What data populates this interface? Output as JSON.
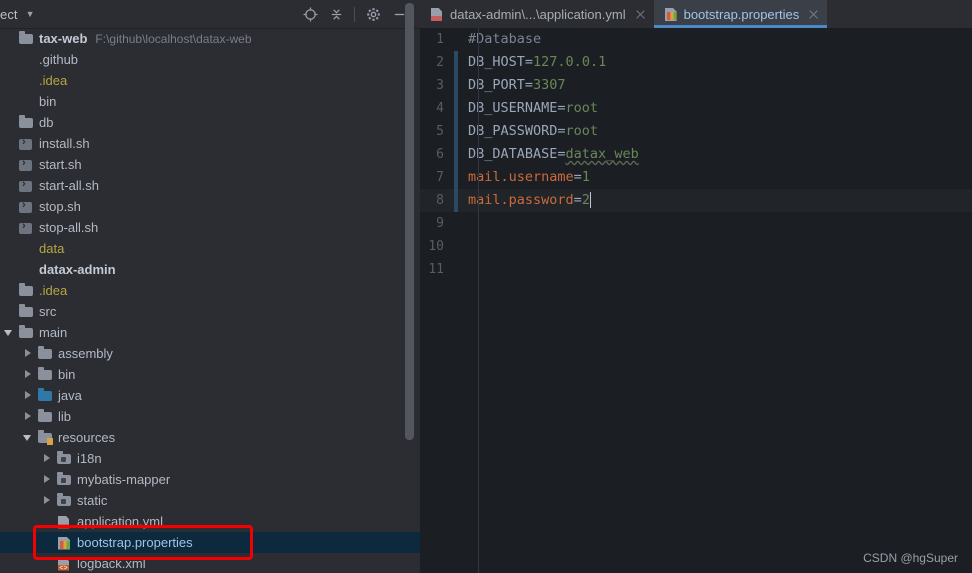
{
  "project_panel": {
    "title": "ect",
    "title_caret": "▼",
    "tools": [
      {
        "name": "locate-icon",
        "label": "Select Opened File"
      },
      {
        "name": "collapse-all-icon",
        "label": "Collapse All"
      },
      {
        "name": "gear-icon",
        "label": "Settings"
      },
      {
        "name": "minimize-icon",
        "label": "Hide"
      }
    ],
    "tree": [
      {
        "label": "tax-web",
        "path": "F:\\github\\localhost\\datax-web",
        "icon": "folder-icon",
        "indent": 0,
        "twist": "none",
        "style": "bold",
        "selected": false
      },
      {
        "label": ".github",
        "path": "",
        "icon": "none",
        "indent": 0,
        "twist": "none",
        "style": "normal",
        "selected": false
      },
      {
        "label": ".idea",
        "path": "",
        "icon": "none",
        "indent": 0,
        "twist": "none",
        "style": "yellow",
        "selected": false
      },
      {
        "label": "bin",
        "path": "",
        "icon": "none",
        "indent": 0,
        "twist": "none",
        "style": "normal",
        "selected": false
      },
      {
        "label": "db",
        "path": "",
        "icon": "folder-icon",
        "indent": 0,
        "twist": "none",
        "style": "normal",
        "selected": false
      },
      {
        "label": "install.sh",
        "path": "",
        "icon": "shell-script-icon",
        "indent": 0,
        "twist": "none",
        "style": "normal",
        "selected": false
      },
      {
        "label": "start.sh",
        "path": "",
        "icon": "shell-script-icon",
        "indent": 0,
        "twist": "none",
        "style": "normal",
        "selected": false
      },
      {
        "label": "start-all.sh",
        "path": "",
        "icon": "shell-script-icon",
        "indent": 0,
        "twist": "none",
        "style": "normal",
        "selected": false
      },
      {
        "label": "stop.sh",
        "path": "",
        "icon": "shell-script-icon",
        "indent": 0,
        "twist": "none",
        "style": "normal",
        "selected": false
      },
      {
        "label": "stop-all.sh",
        "path": "",
        "icon": "shell-script-icon",
        "indent": 0,
        "twist": "none",
        "style": "normal",
        "selected": false
      },
      {
        "label": "data",
        "path": "",
        "icon": "none",
        "indent": 0,
        "twist": "none",
        "style": "yellow",
        "selected": false
      },
      {
        "label": "datax-admin",
        "path": "",
        "icon": "none",
        "indent": 0,
        "twist": "none",
        "style": "bold",
        "selected": false
      },
      {
        "label": ".idea",
        "path": "",
        "icon": "folder-icon",
        "indent": 0,
        "twist": "none",
        "style": "yellow",
        "selected": false
      },
      {
        "label": "src",
        "path": "",
        "icon": "folder-icon",
        "indent": 0,
        "twist": "none",
        "style": "normal",
        "selected": false
      },
      {
        "label": "main",
        "path": "",
        "icon": "folder-icon",
        "indent": 0,
        "twist": "expanded",
        "style": "normal",
        "selected": false
      },
      {
        "label": "assembly",
        "path": "",
        "icon": "folder-icon",
        "indent": 1,
        "twist": "collapsed",
        "style": "normal",
        "selected": false
      },
      {
        "label": "bin",
        "path": "",
        "icon": "folder-icon",
        "indent": 1,
        "twist": "collapsed",
        "style": "normal",
        "selected": false
      },
      {
        "label": "java",
        "path": "",
        "icon": "folder-source-icon",
        "indent": 1,
        "twist": "collapsed",
        "style": "normal",
        "selected": false
      },
      {
        "label": "lib",
        "path": "",
        "icon": "folder-icon",
        "indent": 1,
        "twist": "collapsed",
        "style": "normal",
        "selected": false
      },
      {
        "label": "resources",
        "path": "",
        "icon": "folder-resources-icon",
        "indent": 1,
        "twist": "expanded",
        "style": "normal",
        "selected": false
      },
      {
        "label": "i18n",
        "path": "",
        "icon": "folder-package-icon",
        "indent": 2,
        "twist": "collapsed",
        "style": "normal",
        "selected": false
      },
      {
        "label": "mybatis-mapper",
        "path": "",
        "icon": "folder-package-icon",
        "indent": 2,
        "twist": "collapsed",
        "style": "normal",
        "selected": false
      },
      {
        "label": "static",
        "path": "",
        "icon": "folder-package-icon",
        "indent": 2,
        "twist": "collapsed",
        "style": "normal",
        "selected": false
      },
      {
        "label": "application.yml",
        "path": "",
        "icon": "yml-file-icon",
        "indent": 2,
        "twist": "none",
        "style": "normal",
        "selected": false
      },
      {
        "label": "bootstrap.properties",
        "path": "",
        "icon": "properties-file-icon",
        "indent": 2,
        "twist": "none",
        "style": "selected",
        "selected": true
      },
      {
        "label": "logback.xml",
        "path": "",
        "icon": "xml-file-icon",
        "indent": 2,
        "twist": "none",
        "style": "normal",
        "selected": false
      }
    ]
  },
  "editor": {
    "tabs": [
      {
        "label": "datax-admin\\...\\application.yml",
        "icon": "yml-file-icon",
        "active": false
      },
      {
        "label": "bootstrap.properties",
        "icon": "properties-file-icon",
        "active": true
      }
    ],
    "lines": [
      {
        "num": "1",
        "changed": false,
        "current": false,
        "type": "comment",
        "text": "#Database"
      },
      {
        "num": "2",
        "changed": true,
        "current": false,
        "type": "kv",
        "key": "DB_HOST",
        "eq": "=",
        "value": "127.0.0.1",
        "key_style": "key",
        "value_style": "val"
      },
      {
        "num": "3",
        "changed": true,
        "current": false,
        "type": "kv",
        "key": "DB_PORT",
        "eq": "=",
        "value": "3307",
        "key_style": "key",
        "value_style": "val"
      },
      {
        "num": "4",
        "changed": true,
        "current": false,
        "type": "kv",
        "key": "DB_USERNAME",
        "eq": "=",
        "value": "root",
        "key_style": "key",
        "value_style": "val"
      },
      {
        "num": "5",
        "changed": true,
        "current": false,
        "type": "kv",
        "key": "DB_PASSWORD",
        "eq": "=",
        "value": "root",
        "key_style": "key",
        "value_style": "val"
      },
      {
        "num": "6",
        "changed": true,
        "current": false,
        "type": "kv",
        "key": "DB_DATABASE",
        "eq": "=",
        "value": "datax_web",
        "key_style": "key",
        "value_style": "val-wavy"
      },
      {
        "num": "7",
        "changed": true,
        "current": false,
        "type": "kv",
        "key": "mail.username",
        "eq": "=",
        "value": "1",
        "key_style": "key2",
        "value_style": "val"
      },
      {
        "num": "8",
        "changed": true,
        "current": true,
        "type": "kv",
        "key": "mail.password",
        "eq": "=",
        "value": "2",
        "key_style": "key2",
        "value_style": "val"
      },
      {
        "num": "9",
        "changed": false,
        "current": false,
        "type": "empty",
        "text": ""
      },
      {
        "num": "10",
        "changed": false,
        "current": false,
        "type": "empty",
        "text": ""
      },
      {
        "num": "11",
        "changed": false,
        "current": false,
        "type": "empty",
        "text": ""
      }
    ]
  },
  "watermark": "CSDN @hgSuper",
  "colors": {
    "panel_bg": "#2b2d33",
    "editor_bg": "#1b1e23",
    "tab_active_bg": "#3b4048",
    "tab_underline": "#4a88c7",
    "selection_bg": "#0d293e",
    "annotation_red": "#f50000",
    "string_green": "#6a8759",
    "key_orange": "#cc6a3c",
    "folder_gray": "#8a909c",
    "folder_blue": "#2f79a8",
    "yellow_text": "#b5a642"
  }
}
